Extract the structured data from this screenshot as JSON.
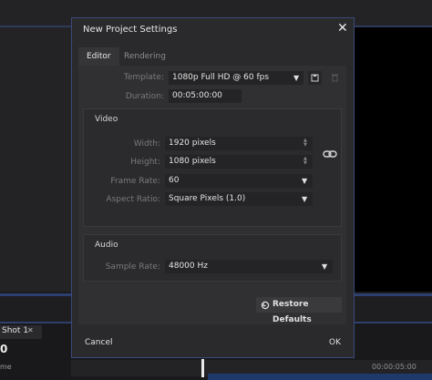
{
  "background": {
    "shot_tab": "Shot 1",
    "shot_close": "✕",
    "shot_timecode": "0",
    "shot_me": "me",
    "timeline_timecode": "00:00:05:00"
  },
  "dialog": {
    "title": "New Project Settings",
    "close": "✕",
    "tabs": [
      {
        "label": "Editor"
      },
      {
        "label": "Rendering"
      }
    ],
    "template": {
      "label": "Template:",
      "value": "1080p Full HD @ 60 fps"
    },
    "duration": {
      "label": "Duration:",
      "value": "00:05:00:00"
    },
    "video": {
      "title": "Video",
      "width": {
        "label": "Width:",
        "value": "1920 pixels"
      },
      "height": {
        "label": "Height:",
        "value": "1080 pixels"
      },
      "frame_rate": {
        "label": "Frame Rate:",
        "value": "60"
      },
      "aspect_ratio": {
        "label": "Aspect Ratio:",
        "value": "Square Pixels (1.0)"
      }
    },
    "audio": {
      "title": "Audio",
      "sample_rate": {
        "label": "Sample Rate:",
        "value": "48000 Hz"
      }
    },
    "restore_defaults": "Restore Defaults",
    "cancel": "Cancel",
    "ok": "OK"
  },
  "colors": {
    "accent_border": "#3a4a7a",
    "timeline_blue": "#2c3f6e"
  }
}
